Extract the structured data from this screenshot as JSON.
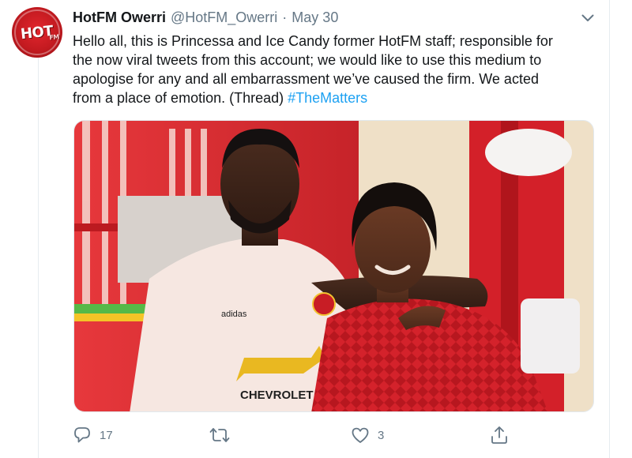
{
  "tweet": {
    "display_name": "HotFM Owerri",
    "handle": "@HotFM_Owerri",
    "separator": "·",
    "date": "May 30",
    "avatar_text": "HOT",
    "avatar_subtext": "FM",
    "text_lines": [
      "Hello all, this is Princessa and Ice Candy former HotFM staff; responsible for",
      "the now viral tweets from this account; we would like to use this medium to",
      "apologise for any and all embarrassment we’ve caused the firm. We acted",
      "from a place of emotion. (Thread) "
    ],
    "hashtag": "#TheMatters",
    "photo": {
      "shirt_brand": "adidas",
      "shirt_sponsor": "CHEVROLET"
    }
  },
  "actions": {
    "reply_count": "17",
    "retweet_count": "",
    "like_count": "3",
    "share_count": ""
  },
  "colors": {
    "accent": "#1da1f2",
    "secondary_text": "#657786",
    "avatar_red": "#e2262d"
  },
  "icons": [
    "reply-icon",
    "retweet-icon",
    "like-icon",
    "share-icon",
    "chevron-down-icon"
  ]
}
